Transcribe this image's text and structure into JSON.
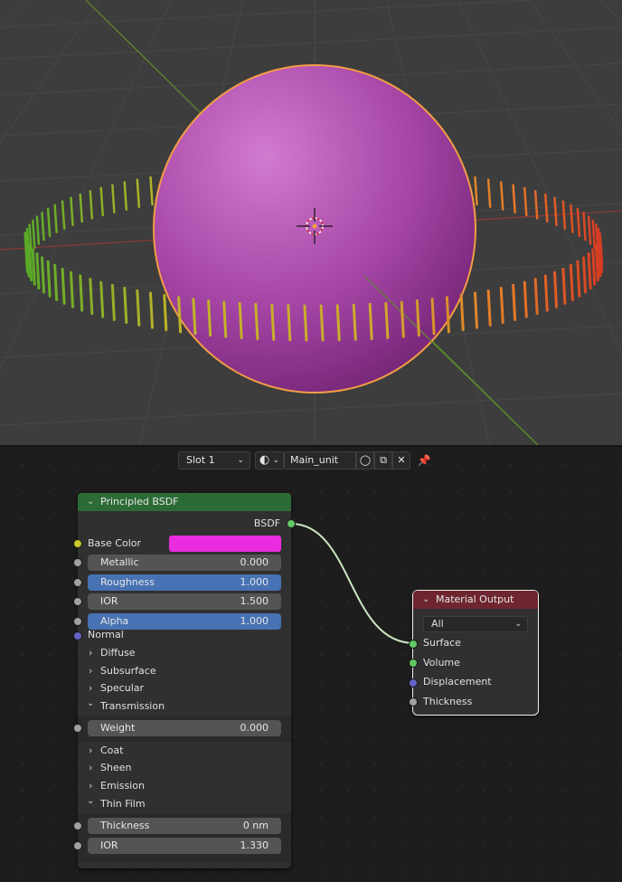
{
  "header": {
    "slot_label": "Slot 1",
    "material_name": "Main_unit"
  },
  "principled": {
    "title": "Principled BSDF",
    "output_label": "BSDF",
    "base_color_label": "Base Color",
    "base_color": "#ea2ce0",
    "metallic": {
      "label": "Metallic",
      "value": "0.000"
    },
    "roughness": {
      "label": "Roughness",
      "value": "1.000"
    },
    "ior": {
      "label": "IOR",
      "value": "1.500"
    },
    "alpha": {
      "label": "Alpha",
      "value": "1.000"
    },
    "normal_label": "Normal",
    "panels": {
      "diffuse": "Diffuse",
      "subsurface": "Subsurface",
      "specular": "Specular",
      "transmission": "Transmission",
      "coat": "Coat",
      "sheen": "Sheen",
      "emission": "Emission",
      "thin_film": "Thin Film"
    },
    "transmission_weight": {
      "label": "Weight",
      "value": "0.000"
    },
    "thin_film_thickness": {
      "label": "Thickness",
      "value": "0 nm"
    },
    "thin_film_ior": {
      "label": "IOR",
      "value": "1.330"
    }
  },
  "material_output": {
    "title": "Material Output",
    "target": "All",
    "inputs": [
      "Surface",
      "Volume",
      "Displacement",
      "Thickness"
    ]
  },
  "colors": {
    "header_green": "#2c6b36",
    "header_red": "#6e2530",
    "shader_socket": "#63c763",
    "color_socket": "#c7c729",
    "float_socket": "#a1a1a1",
    "vector_socket": "#6363c7",
    "selection_outline": "#f0f0f0",
    "field_blue": "#4772b3",
    "sphere": "#a84aa8",
    "sphere_outline": "#f39c45"
  }
}
